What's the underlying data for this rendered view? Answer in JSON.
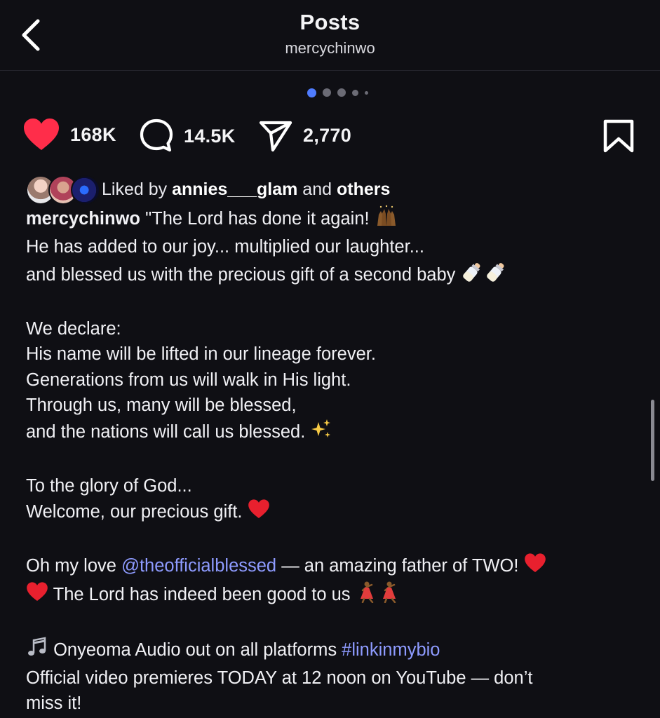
{
  "header": {
    "title": "Posts",
    "subtitle": "mercychinwo"
  },
  "carousel": {
    "total_dots": 5,
    "active_index": 0
  },
  "actions": {
    "likes": "168K",
    "comments": "14.5K",
    "shares": "2,770"
  },
  "liked_by": {
    "prefix": "Liked by",
    "user": "annies___glam",
    "connector": "and",
    "suffix": "others"
  },
  "caption": {
    "username": "mercychinwo",
    "line1": "\"The Lord has done it again!",
    "line2": "He has added to our joy... multiplied our laughter...",
    "line3": "and blessed us with the precious gift of a second baby",
    "line4": "We declare:",
    "line5": "His name will be lifted in our lineage forever.",
    "line6": "Generations from us will walk in His light.",
    "line7": "Through us, many will be blessed,",
    "line8": "and the nations will call us blessed.",
    "line9": "To the glory of God...",
    "line10": "Welcome, our precious gift.",
    "line11_prefix": "Oh my love",
    "mention": "@theofficialblessed",
    "line11_suffix": "— an amazing father of TWO!",
    "line12": "The Lord has indeed been good to us",
    "line13_text": "Onyeoma Audio out on all platforms",
    "hashtag": "#linkinmybio",
    "line14": "Official video premieres TODAY at 12 noon on YouTube — don’t",
    "line15": "miss it!"
  },
  "colors": {
    "background": "#0f0f14",
    "heart": "#ff2d4a",
    "link": "#8e9bff",
    "active_dot": "#4f7cff"
  },
  "icons": [
    "back-chevron-icon",
    "heart-icon",
    "comment-icon",
    "share-icon",
    "bookmark-icon"
  ]
}
